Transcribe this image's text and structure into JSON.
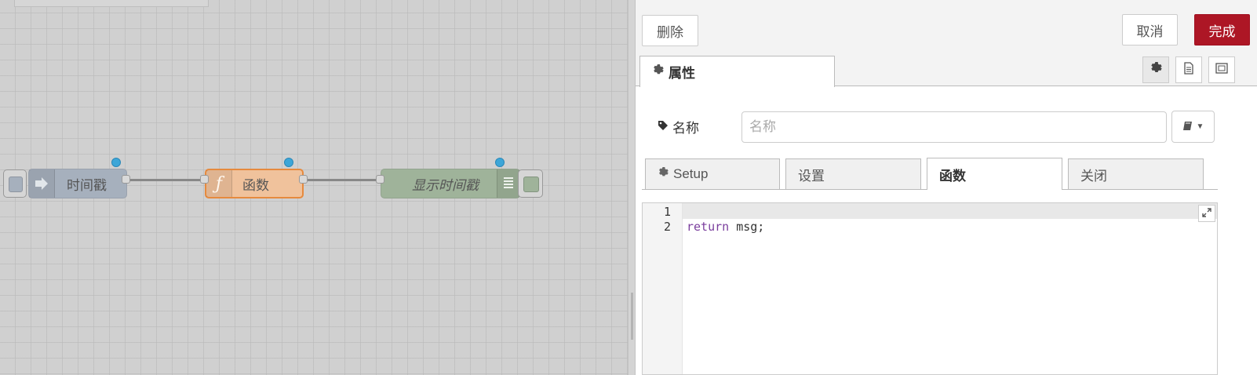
{
  "flow": {
    "nodes": [
      {
        "label": "时间戳",
        "type": "inject",
        "icon": "arrow-in-icon"
      },
      {
        "label": "函数",
        "type": "function",
        "icon": "function-f-icon"
      },
      {
        "label": "显示时间戳",
        "type": "debug",
        "icon": "list-lines-icon"
      }
    ],
    "colors": {
      "inject": "#a6b0bd",
      "function": "#f0c29c",
      "debug": "#9fb39a",
      "changed_dot": "#3da6d8"
    }
  },
  "editor": {
    "toolbar": {
      "delete_label": "删除",
      "cancel_label": "取消",
      "done_label": "完成"
    },
    "properties_tab": "属性",
    "name": {
      "label": "名称",
      "placeholder": "名称",
      "value": ""
    },
    "subtabs": [
      {
        "label": "Setup",
        "active": false
      },
      {
        "label": "设置",
        "active": false
      },
      {
        "label": "函数",
        "active": true
      },
      {
        "label": "关闭",
        "active": false
      }
    ],
    "code": {
      "lines": [
        {
          "num": "1",
          "text": ""
        },
        {
          "num": "2",
          "keyword": "return",
          "rest": " msg;"
        }
      ]
    },
    "accent": "#ad1625"
  }
}
